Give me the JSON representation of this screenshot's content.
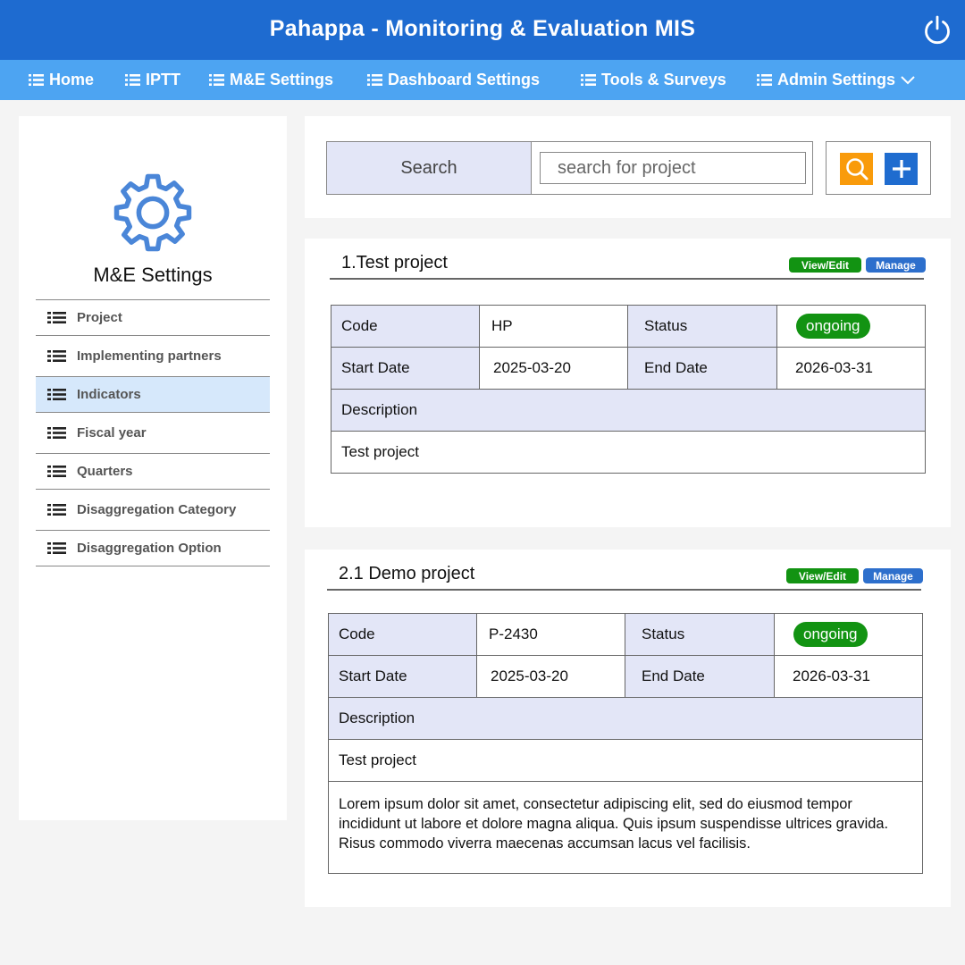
{
  "app": {
    "title": "Pahappa - Monitoring & Evaluation MIS"
  },
  "nav": {
    "items": [
      {
        "label": "Home"
      },
      {
        "label": "IPTT"
      },
      {
        "label": "M&E Settings"
      },
      {
        "label": "Dashboard Settings"
      },
      {
        "label": "Tools & Surveys"
      },
      {
        "label": "Admin Settings"
      }
    ]
  },
  "sidebar": {
    "title": "M&E Settings",
    "items": [
      {
        "label": "Project"
      },
      {
        "label": "Implementing partners"
      },
      {
        "label": "Indicators"
      },
      {
        "label": "Fiscal year"
      },
      {
        "label": "Quarters"
      },
      {
        "label": "Disaggregation Category"
      },
      {
        "label": "Disaggregation Option"
      }
    ],
    "active_item": "Indicators"
  },
  "search": {
    "label": "Search",
    "placeholder": "search for project",
    "value": ""
  },
  "projects": [
    {
      "title": "1.Test project",
      "view_edit": "View/Edit",
      "manage": "Manage",
      "code_label": "Code",
      "code": "HP",
      "status_label": "Status",
      "status": "ongoing",
      "start_label": "Start Date",
      "start": "2025-03-20",
      "end_label": "End Date",
      "end": "2026-03-31",
      "description_label": "Description",
      "description": "Test project"
    },
    {
      "title": "2.1 Demo project",
      "view_edit": "View/Edit",
      "manage": "Manage",
      "code_label": "Code",
      "code": "P-2430",
      "status_label": "Status",
      "status": "ongoing",
      "start_label": "Start Date",
      "start": "2025-03-20",
      "end_label": "End Date",
      "end": "2026-03-31",
      "description_label": "Description",
      "description": "Test project",
      "extra_text": "Lorem ipsum dolor sit amet, consectetur adipiscing elit, sed do eiusmod tempor incididunt ut labore et dolore magna aliqua. Quis ipsum suspendisse ultrices gravida. Risus commodo viverra maecenas accumsan lacus vel facilisis."
    }
  ],
  "colors": {
    "header": "#1e6bd0",
    "nav": "#4da4f2",
    "label_bg": "#e3e6f7",
    "active_bg": "#d6e8fb",
    "status_green": "#129312",
    "search_button": "#f99b0b",
    "add_button": "#1f6ccf"
  },
  "icons": {
    "power": "power-icon",
    "nav": "list-icon",
    "dropdown": "chevron-down-icon",
    "sidebar": "gear-icon",
    "search": "search-icon",
    "add": "plus-icon"
  }
}
